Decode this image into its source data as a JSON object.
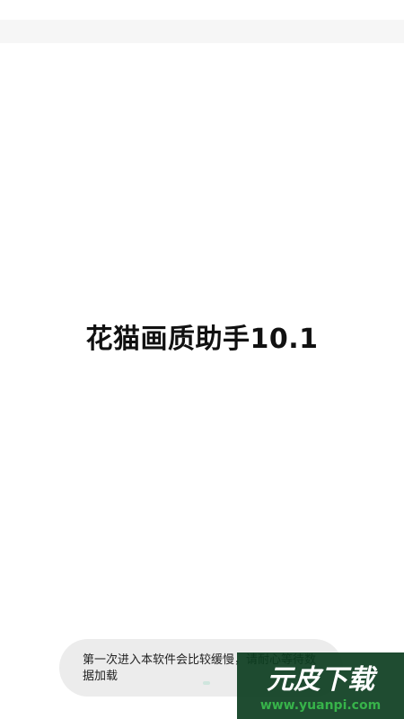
{
  "splash": {
    "title": "花猫画质助手10.1"
  },
  "toast": {
    "message": "第一次进入本软件会比较缓慢，请耐心等待数据加载"
  },
  "watermark": {
    "brand": "元皮下载",
    "url": "www.yuanpi.com",
    "colors": {
      "background": "#0c3d1f",
      "primary": "#ffffff",
      "accent": "#37b34a"
    }
  }
}
